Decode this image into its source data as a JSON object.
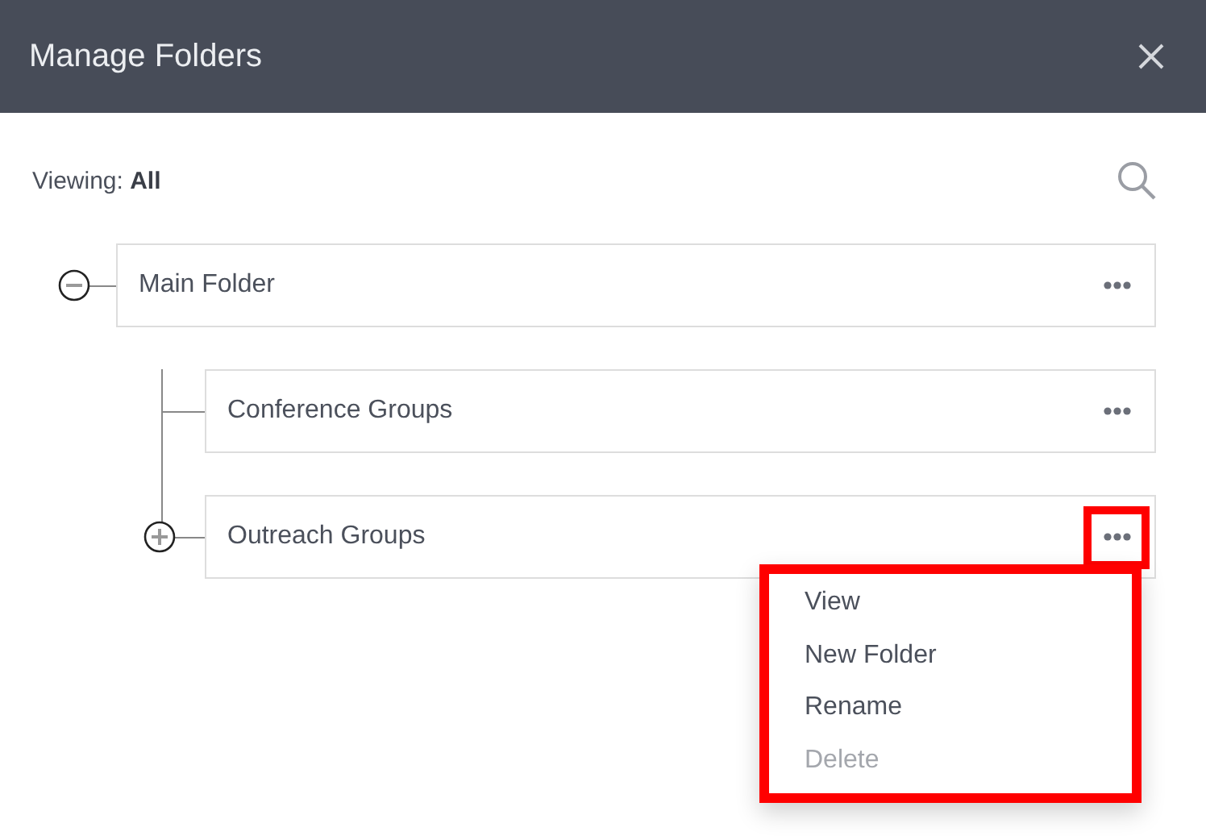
{
  "window": {
    "title": "Manage Folders"
  },
  "viewing": {
    "label": "Viewing:",
    "value": "All"
  },
  "folders": [
    {
      "name": "Main Folder",
      "expanded": true,
      "more_highlighted": false,
      "children": [
        {
          "name": "Conference Groups",
          "more_highlighted": false
        },
        {
          "name": "Outreach Groups",
          "expanded": false,
          "more_highlighted": true,
          "menu": [
            {
              "label": "View",
              "disabled": false
            },
            {
              "label": "New Folder",
              "disabled": false
            },
            {
              "label": "Rename",
              "disabled": false
            },
            {
              "label": "Delete",
              "disabled": true
            }
          ]
        }
      ]
    }
  ]
}
